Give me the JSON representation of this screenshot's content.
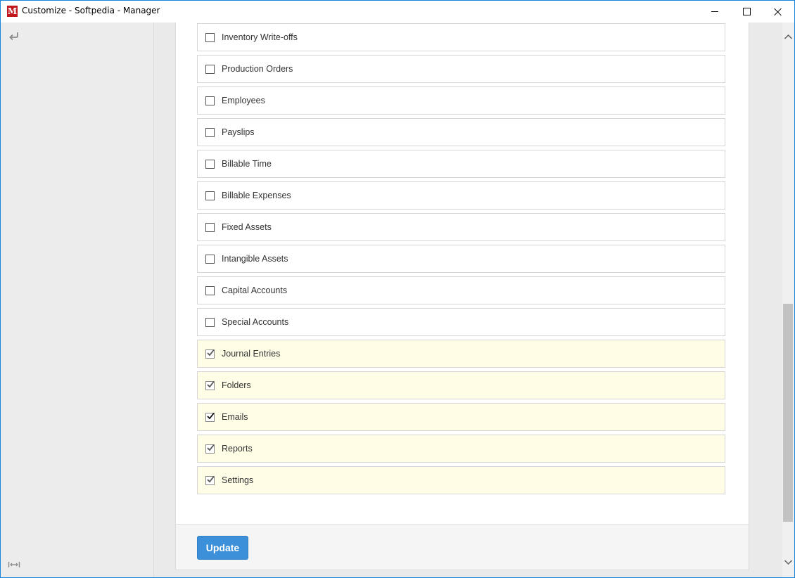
{
  "window": {
    "title": "Customize - Softpedia - Manager",
    "app_icon_letter": "M",
    "controls": [
      "minimize-icon",
      "maximize-icon",
      "close-icon"
    ]
  },
  "sidebar": {
    "back_icon": "back-arrow-icon",
    "expand_icon": "expand-width-icon"
  },
  "modules": [
    {
      "label": "Inventory Write-offs",
      "checked": false
    },
    {
      "label": "Production Orders",
      "checked": false
    },
    {
      "label": "Employees",
      "checked": false
    },
    {
      "label": "Payslips",
      "checked": false
    },
    {
      "label": "Billable Time",
      "checked": false
    },
    {
      "label": "Billable Expenses",
      "checked": false
    },
    {
      "label": "Fixed Assets",
      "checked": false
    },
    {
      "label": "Intangible Assets",
      "checked": false
    },
    {
      "label": "Capital Accounts",
      "checked": false
    },
    {
      "label": "Special Accounts",
      "checked": false
    },
    {
      "label": "Journal Entries",
      "checked": true
    },
    {
      "label": "Folders",
      "checked": true
    },
    {
      "label": "Emails",
      "checked": true
    },
    {
      "label": "Reports",
      "checked": true
    },
    {
      "label": "Settings",
      "checked": true
    }
  ],
  "footer": {
    "update_label": "Update"
  },
  "colors": {
    "accent": "#3c8fd9",
    "checked_row": "#fffde6",
    "app_icon": "#c0171d"
  }
}
